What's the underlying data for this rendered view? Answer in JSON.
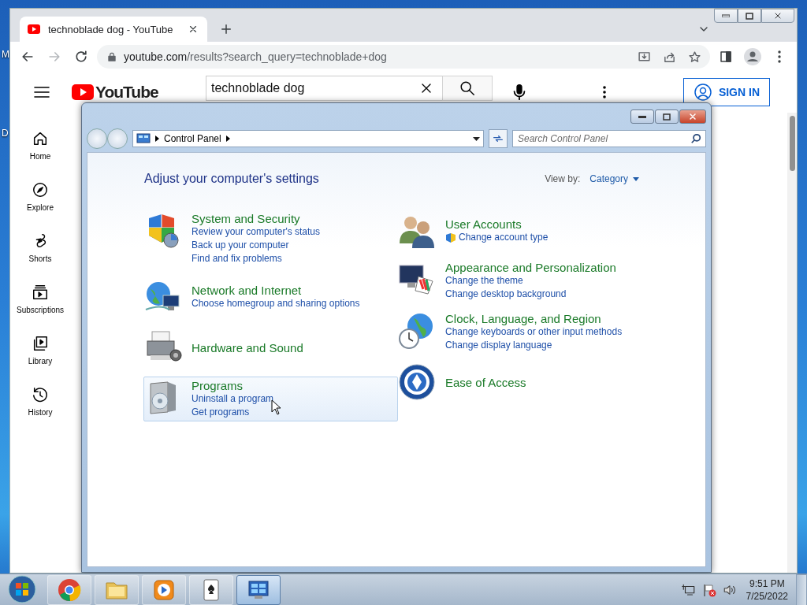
{
  "desktop_labels": [
    "M",
    "D"
  ],
  "browser": {
    "tabs": [
      {
        "title": "technoblade dog - YouTube",
        "selected": true
      }
    ],
    "address": {
      "domain": "youtube.com",
      "path": "/results?search_query=technoblade+dog"
    }
  },
  "youtube": {
    "logo": "YouTube",
    "search": {
      "value": "technoblade dog"
    },
    "sign_in": "SIGN IN",
    "sidebar": [
      {
        "kind": "home",
        "label": "Home"
      },
      {
        "kind": "explore",
        "label": "Explore"
      },
      {
        "kind": "shorts",
        "label": "Shorts"
      },
      {
        "kind": "subscriptions",
        "label": "Subscriptions"
      },
      {
        "kind": "library",
        "label": "Library"
      },
      {
        "kind": "history",
        "label": "History"
      }
    ]
  },
  "control_panel": {
    "breadcrumb": "Control Panel",
    "search": {
      "placeholder": "Search Control Panel"
    },
    "heading": "Adjust your computer's settings",
    "view_by": {
      "label": "View by:",
      "value": "Category"
    },
    "left_column": [
      {
        "kind": "security",
        "title": "System and Security",
        "highlighted": false,
        "links": [
          {
            "text": "Review your computer's status",
            "shielded": false
          },
          {
            "text": "Back up your computer",
            "shielded": false
          },
          {
            "text": "Find and fix problems",
            "shielded": false
          }
        ]
      },
      {
        "kind": "network",
        "title": "Network and Internet",
        "highlighted": false,
        "links": [
          {
            "text": "Choose homegroup and sharing options",
            "shielded": false
          }
        ]
      },
      {
        "kind": "hardware",
        "title": "Hardware and Sound",
        "highlighted": false
      },
      {
        "kind": "programs",
        "title": "Programs",
        "highlighted": true,
        "links": [
          {
            "text": "Uninstall a program",
            "shielded": false
          },
          {
            "text": "Get programs",
            "shielded": false
          }
        ]
      }
    ],
    "right_column": [
      {
        "kind": "users",
        "title": "User Accounts",
        "highlighted": false,
        "links": [
          {
            "text": "Change account type",
            "shielded": true
          }
        ]
      },
      {
        "kind": "appearance",
        "title": "Appearance and Personalization",
        "highlighted": false,
        "links": [
          {
            "text": "Change the theme",
            "shielded": false
          },
          {
            "text": "Change desktop background",
            "shielded": false
          }
        ]
      },
      {
        "kind": "clock",
        "title": "Clock, Language, and Region",
        "highlighted": false,
        "links": [
          {
            "text": "Change keyboards or other input methods",
            "shielded": false
          },
          {
            "text": "Change display language",
            "shielded": false
          }
        ]
      },
      {
        "kind": "access",
        "title": "Ease of Access",
        "highlighted": false
      }
    ]
  },
  "taskbar": {
    "items": [
      {
        "kind": "chrome",
        "active": false
      },
      {
        "kind": "explorer",
        "active": false
      },
      {
        "kind": "media",
        "active": false
      },
      {
        "kind": "cards",
        "active": false
      },
      {
        "kind": "control",
        "active": true
      }
    ],
    "clock": {
      "time": "9:51 PM",
      "date": "7/25/2022"
    }
  }
}
